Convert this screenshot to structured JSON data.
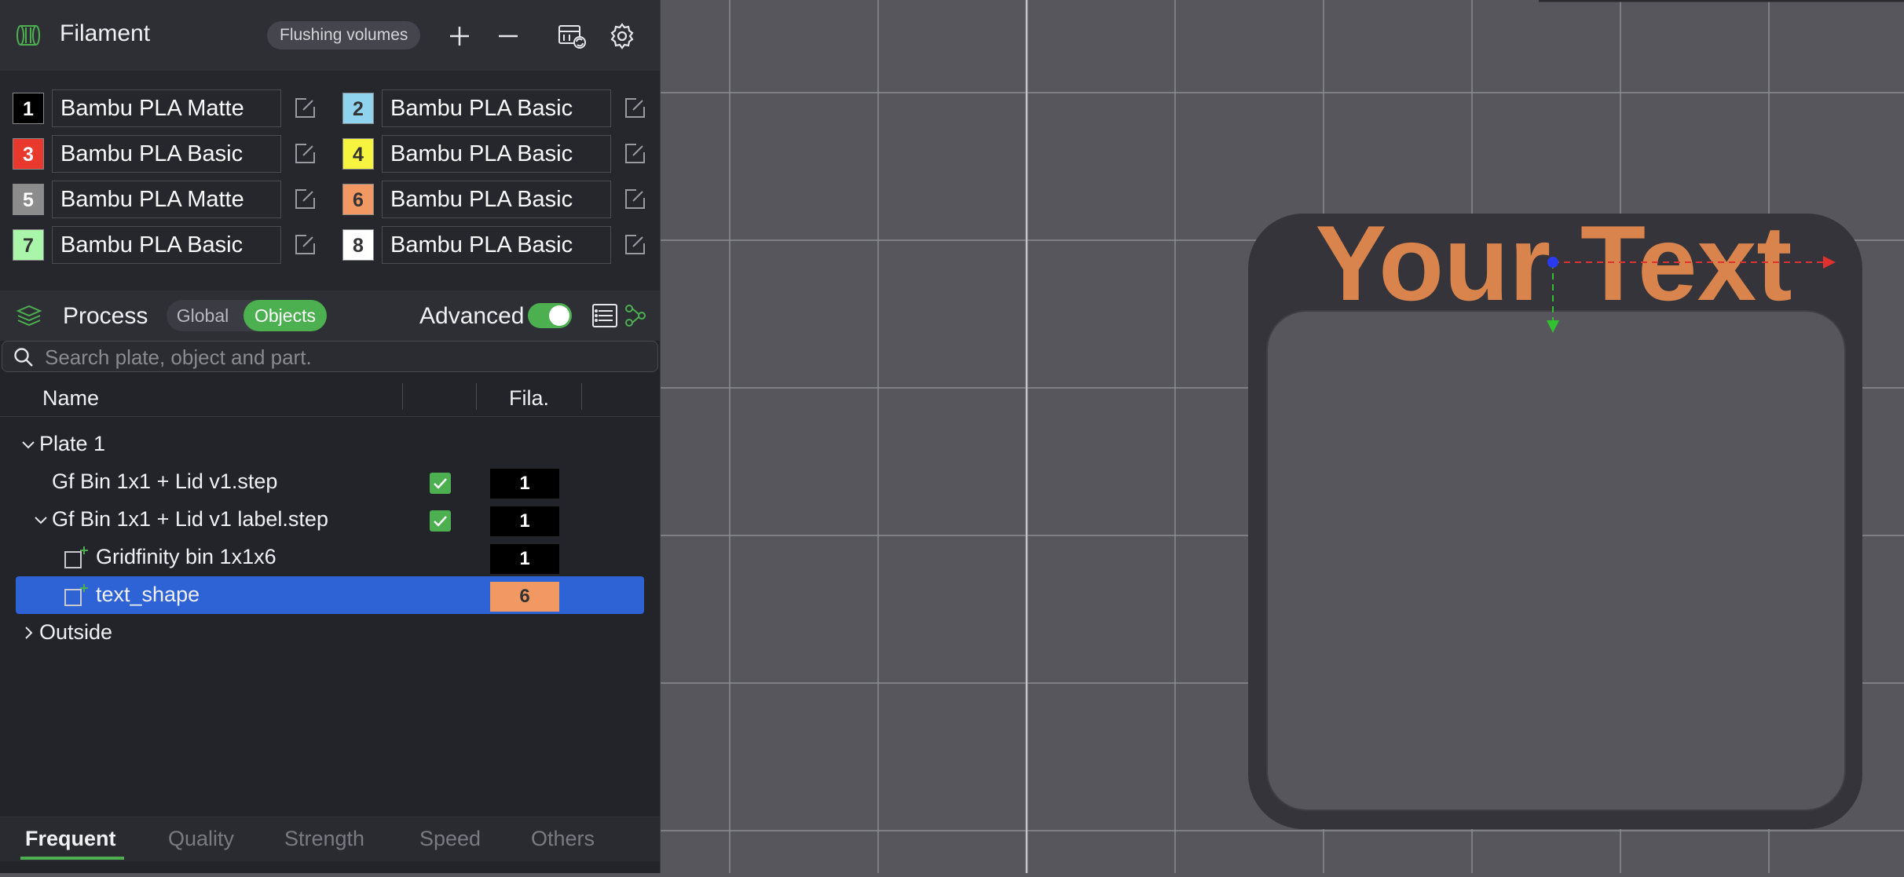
{
  "filament": {
    "title": "Filament",
    "flushing_label": "Flushing volumes",
    "items": [
      {
        "num": "1",
        "color": "#000000",
        "text_color": "#ffffff",
        "name": "Bambu PLA Matte"
      },
      {
        "num": "2",
        "color": "#8fd3ee",
        "text_color": "#333333",
        "name": "Bambu PLA Basic"
      },
      {
        "num": "3",
        "color": "#e8392c",
        "text_color": "#ffffff",
        "name": "Bambu PLA Basic"
      },
      {
        "num": "4",
        "color": "#f7f43f",
        "text_color": "#333333",
        "name": "Bambu PLA Basic"
      },
      {
        "num": "5",
        "color": "#8c8c8c",
        "text_color": "#ffffff",
        "name": "Bambu PLA Matte"
      },
      {
        "num": "6",
        "color": "#f29863",
        "text_color": "#333333",
        "name": "Bambu PLA Basic"
      },
      {
        "num": "7",
        "color": "#a9f5a9",
        "text_color": "#333333",
        "name": "Bambu PLA Basic"
      },
      {
        "num": "8",
        "color": "#ffffff",
        "text_color": "#333333",
        "name": "Bambu PLA Basic"
      }
    ]
  },
  "process": {
    "title": "Process",
    "seg_global": "Global",
    "seg_objects": "Objects",
    "advanced_label": "Advanced",
    "advanced_on": true
  },
  "search": {
    "placeholder": "Search plate, object and part."
  },
  "columns": {
    "name": "Name",
    "fila": "Fila."
  },
  "tree": {
    "plate": "Plate 1",
    "obj1": {
      "label": "Gf Bin 1x1 + Lid v1.step",
      "fila": "1",
      "fila_color": "#000000"
    },
    "obj2": {
      "label": "Gf Bin 1x1 + Lid v1 label.step",
      "fila": "1",
      "fila_color": "#000000"
    },
    "part1": {
      "label": "Gridfinity bin 1x1x6",
      "fila": "1",
      "fila_color": "#000000"
    },
    "part2": {
      "label": "text_shape",
      "fila": "6",
      "fila_color": "#f29863"
    },
    "outside": "Outside"
  },
  "tabs": [
    "Frequent",
    "Quality",
    "Strength",
    "Speed",
    "Others"
  ],
  "viewport": {
    "text": "Your Text",
    "text_color": "#d9844c"
  },
  "colors": {
    "accent": "#4caf50",
    "selection": "#2e63d6"
  }
}
